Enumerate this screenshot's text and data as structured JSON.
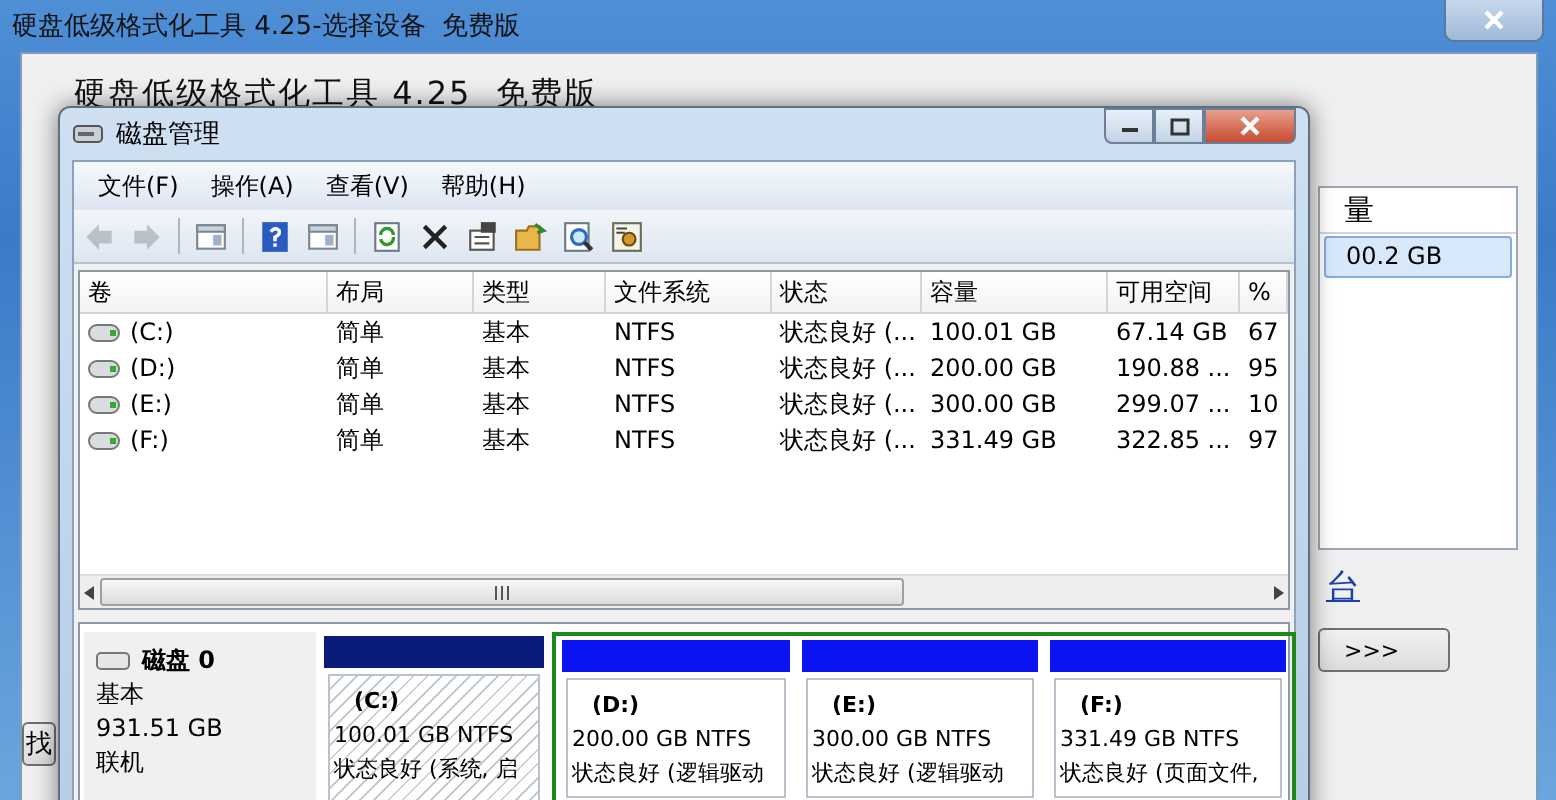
{
  "back_window": {
    "title": "硬盘低级格式化工具 4.25-选择设备  免费版",
    "heading": "硬盘低级格式化工具 4.25  免费版",
    "list_header": "量",
    "list_row": {
      "text": "00.2 GB",
      "selected": true
    },
    "link": "台",
    "next_button": ">>>",
    "find_button": "找"
  },
  "window": {
    "title": "磁盘管理"
  },
  "menu": [
    "文件(F)",
    "操作(A)",
    "查看(V)",
    "帮助(H)"
  ],
  "toolbar": [
    {
      "kind": "back",
      "disabled": true
    },
    {
      "kind": "forward",
      "disabled": true
    },
    {
      "kind": "separator"
    },
    {
      "kind": "panel",
      "disabled": false
    },
    {
      "kind": "separator"
    },
    {
      "kind": "help",
      "disabled": false
    },
    {
      "kind": "panel",
      "disabled": false
    },
    {
      "kind": "separator"
    },
    {
      "kind": "refresh",
      "disabled": false
    },
    {
      "kind": "delete",
      "disabled": false
    },
    {
      "kind": "properties",
      "disabled": false
    },
    {
      "kind": "folder",
      "disabled": false
    },
    {
      "kind": "search",
      "disabled": false
    },
    {
      "kind": "settings",
      "disabled": false
    }
  ],
  "table": {
    "columns": [
      "卷",
      "布局",
      "类型",
      "文件系统",
      "状态",
      "容量",
      "可用空间",
      "%"
    ],
    "rows": [
      {
        "volume": "(C:)",
        "layout": "简单",
        "type": "基本",
        "file_system": "NTFS",
        "status": "状态良好 (...",
        "capacity": "100.01 GB",
        "free": "67.14 GB",
        "percent": "67"
      },
      {
        "volume": "(D:)",
        "layout": "简单",
        "type": "基本",
        "file_system": "NTFS",
        "status": "状态良好 (...",
        "capacity": "200.00 GB",
        "free": "190.88 ...",
        "percent": "95"
      },
      {
        "volume": "(E:)",
        "layout": "简单",
        "type": "基本",
        "file_system": "NTFS",
        "status": "状态良好 (...",
        "capacity": "300.00 GB",
        "free": "299.07 ...",
        "percent": "10"
      },
      {
        "volume": "(F:)",
        "layout": "简单",
        "type": "基本",
        "file_system": "NTFS",
        "status": "状态良好 (...",
        "capacity": "331.49 GB",
        "free": "322.85 ...",
        "percent": "97"
      }
    ]
  },
  "disk": {
    "name": "磁盘 0",
    "type": "基本",
    "size": "931.51 GB",
    "status": "联机"
  },
  "partitions": [
    {
      "kind": "primary",
      "selected": true,
      "label": "(C:)",
      "size": "100.01 GB NTFS",
      "status": "状态良好 (系统, 启"
    },
    {
      "kind": "logical",
      "selected": false,
      "label": "(D:)",
      "size": "200.00 GB NTFS",
      "status": "状态良好 (逻辑驱动"
    },
    {
      "kind": "logical",
      "selected": false,
      "label": "(E:)",
      "size": "300.00 GB NTFS",
      "status": "状态良好 (逻辑驱动"
    },
    {
      "kind": "logical",
      "selected": false,
      "label": "(F:)",
      "size": "331.49 GB NTFS",
      "status": "状态良好 (页面文件,"
    }
  ]
}
